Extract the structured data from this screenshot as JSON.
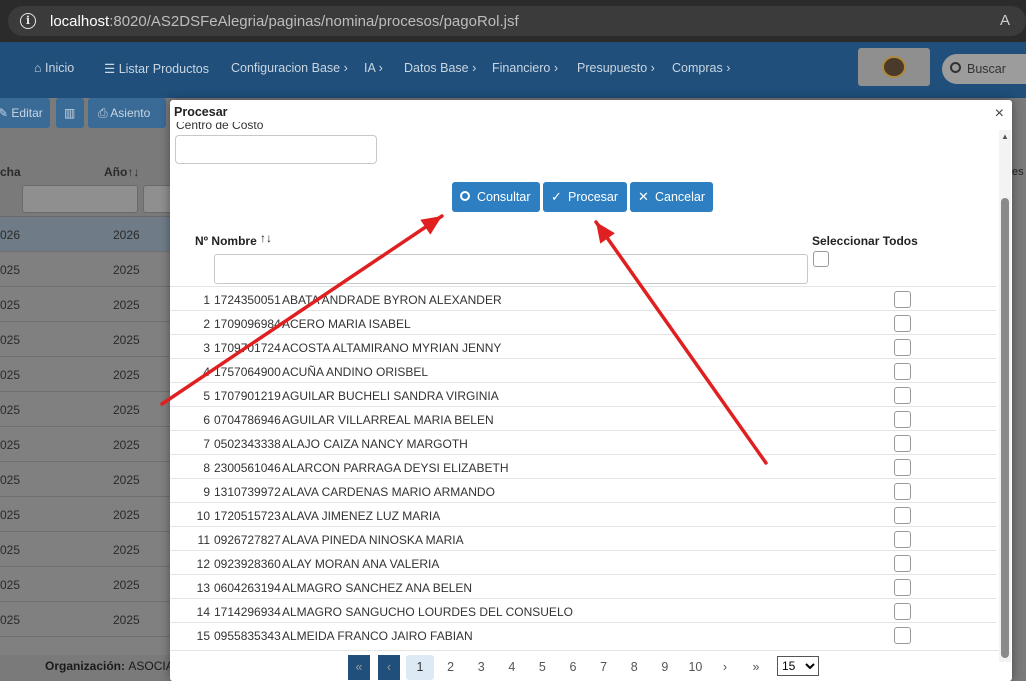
{
  "browser": {
    "url_host": "localhost",
    "url_rest": ":8020/AS2DSFeAlegria/paginas/nomina/procesos/pagoRol.jsf",
    "read_aloud_icon": "A"
  },
  "nav": {
    "items": [
      "Inicio",
      "Listar Productos",
      "Configuracion Base",
      "IA",
      "Datos Base",
      "Financiero",
      "Presupuesto",
      "Compras"
    ],
    "search_label": "Buscar"
  },
  "background": {
    "toolbar": [
      "Editar",
      "Asiento"
    ],
    "headers": [
      "cha",
      "Año"
    ],
    "rows": [
      [
        "026",
        "2026"
      ],
      [
        "025",
        "2025"
      ],
      [
        "025",
        "2025"
      ],
      [
        "025",
        "2025"
      ],
      [
        "025",
        "2025"
      ],
      [
        "025",
        "2025"
      ],
      [
        "025",
        "2025"
      ],
      [
        "025",
        "2025"
      ],
      [
        "025",
        "2025"
      ],
      [
        "025",
        "2025"
      ],
      [
        "025",
        "2025"
      ],
      [
        "025",
        "2025"
      ]
    ],
    "org_label": "Organización:",
    "org_value": "ASOCIA"
  },
  "dialog": {
    "title": "Procesar",
    "close": "×",
    "centro_label": "Centro de Costo",
    "buttons": {
      "consultar": "Consultar",
      "procesar": "Procesar",
      "cancelar": "Cancelar"
    },
    "col_num": "Nº",
    "col_nombre": "Nombre",
    "sort_glyph": "↑↓",
    "col_select_all": "Seleccionar Todos",
    "rows": [
      {
        "n": "1",
        "ced": "1724350051",
        "name": "ABATA ANDRADE BYRON ALEXANDER"
      },
      {
        "n": "2",
        "ced": "1709096984",
        "name": "ACERO MARIA ISABEL"
      },
      {
        "n": "3",
        "ced": "1709701724",
        "name": "ACOSTA ALTAMIRANO MYRIAN JENNY"
      },
      {
        "n": "4",
        "ced": "1757064900",
        "name": "ACUÑA ANDINO ORISBEL"
      },
      {
        "n": "5",
        "ced": "1707901219",
        "name": "AGUILAR BUCHELI SANDRA VIRGINIA"
      },
      {
        "n": "6",
        "ced": "0704786946",
        "name": "AGUILAR VILLARREAL MARIA BELEN"
      },
      {
        "n": "7",
        "ced": "0502343338",
        "name": "ALAJO CAIZA NANCY MARGOTH"
      },
      {
        "n": "8",
        "ced": "2300561046",
        "name": "ALARCON PARRAGA DEYSI ELIZABETH"
      },
      {
        "n": "9",
        "ced": "1310739972",
        "name": "ALAVA CARDENAS MARIO ARMANDO"
      },
      {
        "n": "10",
        "ced": "1720515723",
        "name": "ALAVA JIMENEZ LUZ MARIA"
      },
      {
        "n": "11",
        "ced": "0926727827",
        "name": "ALAVA PINEDA NINOSKA MARIA"
      },
      {
        "n": "12",
        "ced": "0923928360",
        "name": "ALAY MORAN ANA VALERIA"
      },
      {
        "n": "13",
        "ced": "0604263194",
        "name": "ALMAGRO SANCHEZ ANA BELEN"
      },
      {
        "n": "14",
        "ced": "1714296934",
        "name": "ALMAGRO SANGUCHO LOURDES DEL CONSUELO"
      },
      {
        "n": "15",
        "ced": "0955835343",
        "name": "ALMEIDA FRANCO JAIRO FABIAN"
      }
    ],
    "pager": {
      "first": "«",
      "prev": "‹",
      "next": "›",
      "last": "»",
      "pages": [
        "1",
        "2",
        "3",
        "4",
        "5",
        "6",
        "7",
        "8",
        "9",
        "10"
      ],
      "current": "1",
      "page_size": "15"
    }
  },
  "colors": {
    "primary": "#2d7fc1",
    "annotation_arrow": "#e02020"
  }
}
